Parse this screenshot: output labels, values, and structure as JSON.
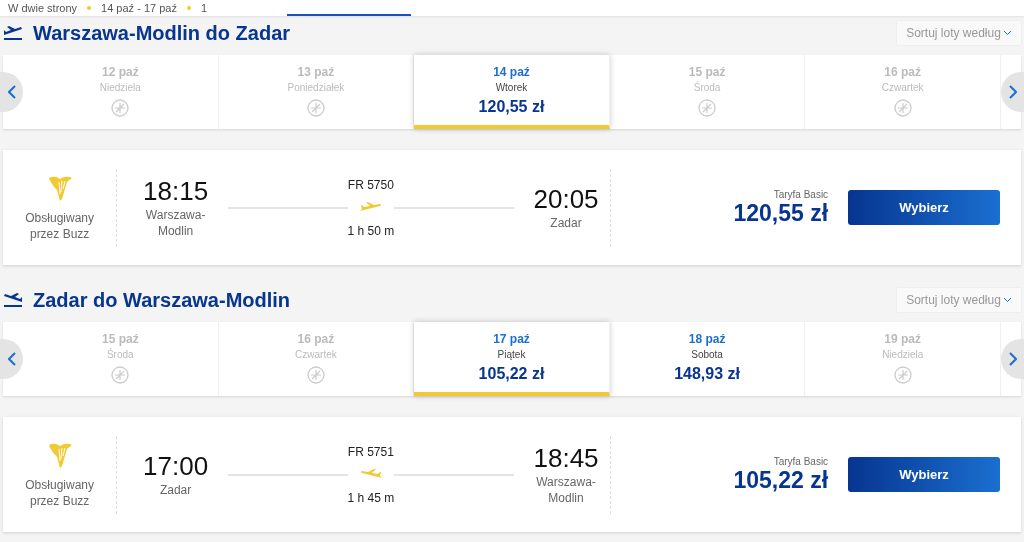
{
  "trip_summary": {
    "trip_type": "W dwie strony",
    "dates": "14 paź - 17 paź",
    "passengers": "1"
  },
  "sections": [
    {
      "title": "Warszawa-Modlin do Zadar",
      "kind": "outbound",
      "sort_label": "Sortuj loty według",
      "dates": [
        {
          "date": "12 paź",
          "weekday": "Niedziela",
          "selected": false
        },
        {
          "date": "13 paź",
          "weekday": "Poniedziałek",
          "selected": false
        },
        {
          "date": "14 paź",
          "weekday": "Wtorek",
          "price": "120,55 zł",
          "selected": true
        },
        {
          "date": "15 paź",
          "weekday": "Środa",
          "selected": false
        },
        {
          "date": "16 paź",
          "weekday": "Czwartek",
          "selected": false
        }
      ],
      "flight": {
        "operator": "Obsługiwany przez Buzz",
        "depart_time": "18:15",
        "depart_city": "Warszawa-Modlin",
        "flight_number": "FR 5750",
        "duration": "1 h 50 m",
        "arrive_time": "20:05",
        "arrive_city": "Zadar",
        "fare": "Taryfa Basic",
        "price": "120,55 zł",
        "button": "Wybierz"
      }
    },
    {
      "title": "Zadar do Warszawa-Modlin",
      "kind": "return",
      "sort_label": "Sortuj loty według",
      "dates": [
        {
          "date": "15 paź",
          "weekday": "Środa",
          "selected": false
        },
        {
          "date": "16 paź",
          "weekday": "Czwartek",
          "selected": false
        },
        {
          "date": "17 paź",
          "weekday": "Piątek",
          "price": "105,22 zł",
          "selected": true
        },
        {
          "date": "18 paź",
          "weekday": "Sobota",
          "price": "148,93 zł",
          "selected": false
        },
        {
          "date": "19 paź",
          "weekday": "Niedziela",
          "selected": false
        }
      ],
      "flight": {
        "operator": "Obsługiwany przez Buzz",
        "depart_time": "17:00",
        "depart_city": "Zadar",
        "flight_number": "FR 5751",
        "duration": "1 h 45 m",
        "arrive_time": "18:45",
        "arrive_city": "Warszawa-Modlin",
        "fare": "Taryfa Basic",
        "price": "105,22 zł",
        "button": "Wybierz"
      }
    }
  ]
}
